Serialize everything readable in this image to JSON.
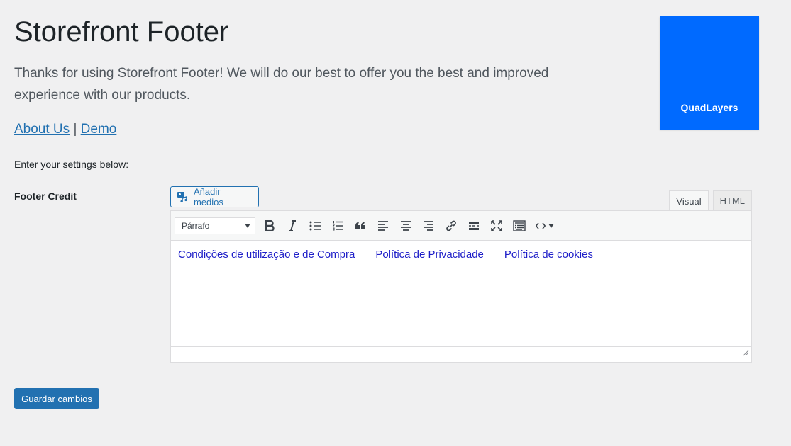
{
  "header": {
    "title": "Storefront Footer",
    "intro": "Thanks for using Storefront Footer! We will do our best to offer you the best and improved experience with our products.",
    "links": [
      {
        "label": "About Us"
      },
      {
        "label": "Demo"
      }
    ],
    "separator": "|"
  },
  "brand": {
    "name": "QuadLayers",
    "color": "#006aff"
  },
  "settings": {
    "intro": "Enter your settings below:",
    "footer_credit_label": "Footer Credit"
  },
  "editor": {
    "add_media_label": "Añadir medios",
    "tabs": [
      {
        "label": "Visual",
        "active": true
      },
      {
        "label": "HTML",
        "active": false
      }
    ],
    "format_select": {
      "value": "Párrafo"
    },
    "toolbar_icons": [
      "bold-icon",
      "italic-icon",
      "bulleted-list-icon",
      "numbered-list-icon",
      "blockquote-icon",
      "align-left-icon",
      "align-center-icon",
      "align-right-icon",
      "link-icon",
      "read-more-icon",
      "fullscreen-icon",
      "toolbar-toggle-icon",
      "code-icon"
    ],
    "content_links": [
      {
        "label": "Condições de utilização e de Compra"
      },
      {
        "label": "Política de Privacidade"
      },
      {
        "label": "Política de cookies"
      }
    ]
  },
  "save_button": {
    "label": "Guardar cambios"
  }
}
